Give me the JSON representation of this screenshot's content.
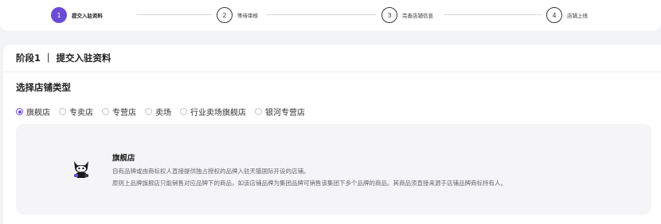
{
  "steps": [
    {
      "num": "1",
      "label": "提交入驻资料"
    },
    {
      "num": "2",
      "label": "等待审核"
    },
    {
      "num": "3",
      "label": "完善店铺信息"
    },
    {
      "num": "4",
      "label": "店铺上线"
    }
  ],
  "stage": {
    "title": "阶段1 ｜ 提交入驻资料"
  },
  "section": {
    "title": "选择店铺类型"
  },
  "store_types": [
    {
      "label": "旗舰店",
      "selected": true
    },
    {
      "label": "专卖店",
      "selected": false
    },
    {
      "label": "专营店",
      "selected": false
    },
    {
      "label": "卖场",
      "selected": false
    },
    {
      "label": "行业卖场旗舰店",
      "selected": false
    },
    {
      "label": "银河专营店",
      "selected": false
    }
  ],
  "description": {
    "title": "旗舰店",
    "line1": "自有品牌或由商标权人直接提供独占授权的品牌入驻天猫国际开设的店铺。",
    "line2": "原则上品牌旗舰店只能销售对应品牌下的商品，如该店铺品牌为集团品牌可销售该集团下多个品牌的商品。其商品须直接来源于店铺品牌商标持有人。"
  },
  "colors": {
    "accent": "#6b4bd6",
    "background": "#f2f3f5"
  }
}
